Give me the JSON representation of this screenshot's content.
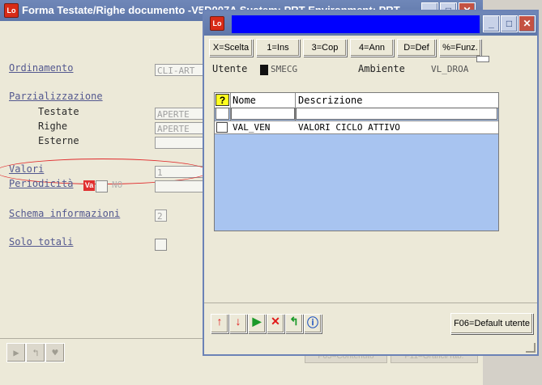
{
  "background_window": {
    "title": "Forma Testate/Righe documento -V5D007A   Sustem: PRT Environment: PRT",
    "app_icon_text": "Lo",
    "fields": {
      "ordinamento_label": "Ordinamento",
      "ordinamento_value": "CLI-ART",
      "parzializzazione_label": "Parzializzazione",
      "testate_label": "Testate",
      "testate_value": "APERTE",
      "righe_label": "Righe",
      "righe_value": "APERTE",
      "esterne_label": "Esterne",
      "valori_label": "Valori",
      "valori_value": "1",
      "periodicita_label": "Periodicità",
      "periodicita_value": "NO",
      "periodicita_badge": "Va",
      "schema_label": "Schema informazioni",
      "schema_value": "2",
      "solo_totali_label": "Solo totali"
    },
    "bottom_buttons": [
      "F05=Contenuto",
      "F11=Grafici/Tab."
    ]
  },
  "dialog": {
    "app_icon_text": "Lo",
    "title": "",
    "toolbar": [
      {
        "label": "X=Scelta"
      },
      {
        "label": "1=Ins"
      },
      {
        "label": "3=Cop"
      },
      {
        "label": "4=Ann"
      },
      {
        "label": "D=Def"
      },
      {
        "label": "%=Funz."
      }
    ],
    "utente_label": "Utente",
    "utente_value": "SMECG",
    "ambiente_label": "Ambiente",
    "ambiente_value": "VL_DROA",
    "grid": {
      "help_symbol": "?",
      "columns": [
        "Nome",
        "Descrizione"
      ],
      "rows": [
        {
          "nome": "VAL_VEN",
          "descrizione": "VALORI CICLO ATTIVO"
        }
      ]
    },
    "default_button": "F06=Default utente"
  },
  "colors": {
    "title_bar": "#6f87b8",
    "dialog_title_block": "#0000ff",
    "grid_background": "#a8c4f0",
    "highlight": "#e0282a"
  }
}
